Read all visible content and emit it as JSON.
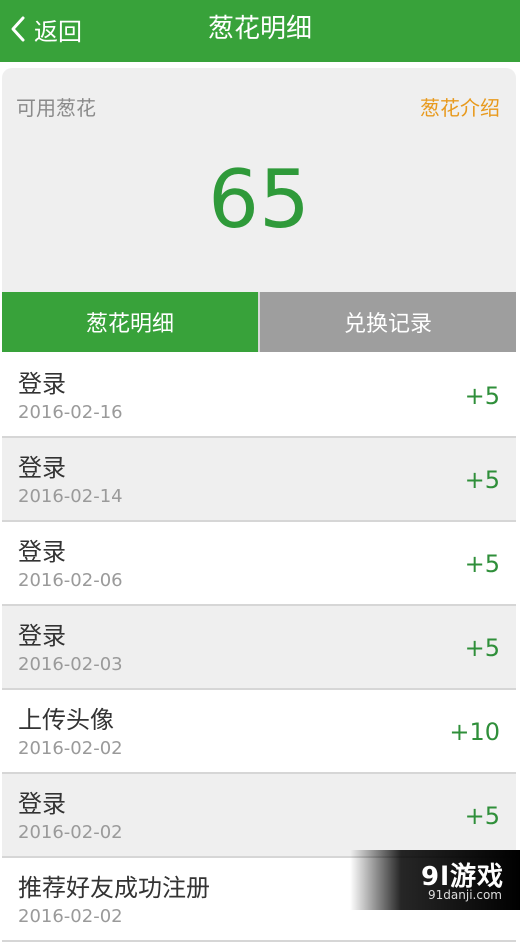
{
  "header": {
    "back_label": "返回",
    "title": "葱花明细"
  },
  "summary": {
    "available_label": "可用葱花",
    "intro_link": "葱花介绍",
    "balance": "65"
  },
  "tabs": [
    {
      "label": "葱花明细",
      "active": true
    },
    {
      "label": "兑换记录",
      "active": false
    }
  ],
  "records": [
    {
      "name": "登录",
      "date": "2016-02-16",
      "points": "+5"
    },
    {
      "name": "登录",
      "date": "2016-02-14",
      "points": "+5"
    },
    {
      "name": "登录",
      "date": "2016-02-06",
      "points": "+5"
    },
    {
      "name": "登录",
      "date": "2016-02-03",
      "points": "+5"
    },
    {
      "name": "上传头像",
      "date": "2016-02-02",
      "points": "+10"
    },
    {
      "name": "登录",
      "date": "2016-02-02",
      "points": "+5"
    },
    {
      "name": "推荐好友成功注册",
      "date": "2016-02-02",
      "points": ""
    }
  ],
  "watermark": {
    "main": "9l游戏",
    "sub": "91danji.com"
  },
  "colors": {
    "brand_green": "#38a23a",
    "balance_green": "#2f9a3a",
    "intro_orange": "#e89a1e",
    "inactive_tab": "#9e9e9e"
  }
}
